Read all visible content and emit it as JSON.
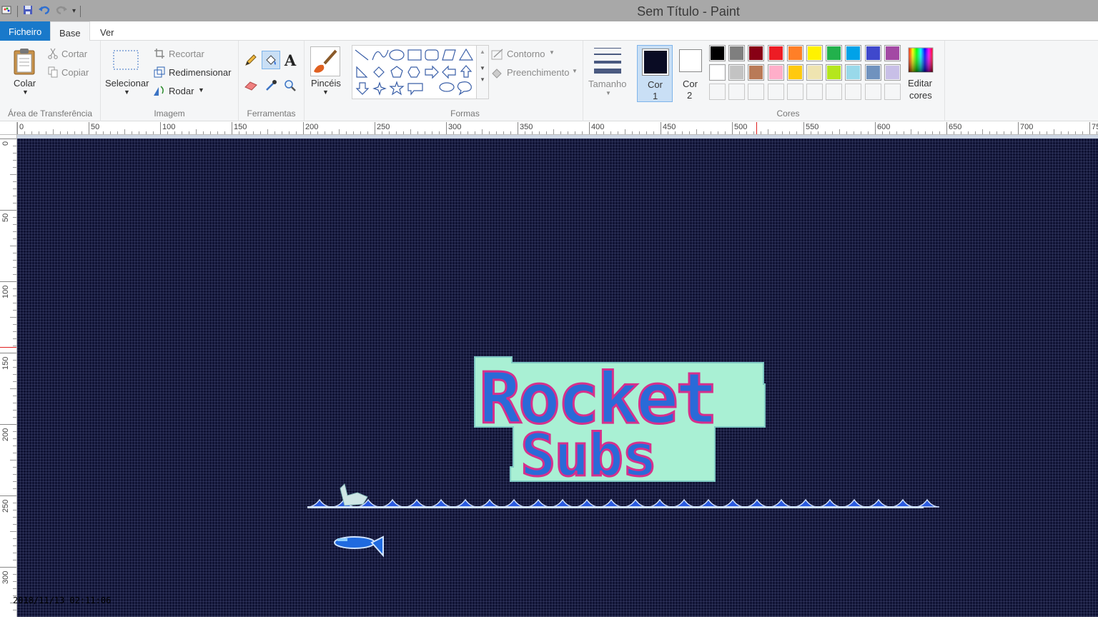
{
  "window": {
    "title": "Sem Título - Paint"
  },
  "quick_access": {
    "icons": [
      "paint-app-icon",
      "save-icon",
      "undo-icon",
      "redo-icon",
      "customize-qat-icon"
    ]
  },
  "tabs": {
    "file": "Ficheiro",
    "home": "Base",
    "view": "Ver"
  },
  "clipboard": {
    "paste": "Colar",
    "cut": "Cortar",
    "copy": "Copiar",
    "label": "Área de Transferência"
  },
  "image": {
    "select": "Selecionar",
    "crop": "Recortar",
    "resize": "Redimensionar",
    "rotate": "Rodar",
    "label": "Imagem"
  },
  "tools": {
    "label": "Ferramentas",
    "brushes": "Pincéis"
  },
  "shapes": {
    "label": "Formas",
    "outline": "Contorno",
    "fill": "Preenchimento"
  },
  "size": {
    "label": "Tamanho"
  },
  "colors": {
    "color1": "Cor",
    "color1_num": "1",
    "color2": "Cor",
    "color2_num": "2",
    "edit": "Editar",
    "edit2": "cores",
    "label": "Cores",
    "color1_value": "#0a0c24",
    "color2_value": "#ffffff",
    "palette_row1": [
      "#000000",
      "#7f7f7f",
      "#880015",
      "#ed1c24",
      "#ff7f27",
      "#fff200",
      "#22b14c",
      "#00a2e8",
      "#3f48cc",
      "#a349a4"
    ],
    "palette_row2": [
      "#ffffff",
      "#c3c3c3",
      "#b97a57",
      "#ffaec9",
      "#ffc90e",
      "#efe4b0",
      "#b5e61d",
      "#99d9ea",
      "#7092be",
      "#c8bfe7"
    ]
  },
  "ruler": {
    "h_ticks": [
      "0",
      "50",
      "100",
      "150",
      "200",
      "250",
      "300",
      "350",
      "400",
      "450",
      "500",
      "550",
      "600",
      "650",
      "700",
      "75"
    ],
    "v_ticks": [
      "0",
      "50",
      "100",
      "150",
      "200",
      "250",
      "300"
    ]
  },
  "canvas": {
    "logo_line1": "Rocket",
    "logo_line2": "Subs",
    "bg_color": "#0f1233"
  },
  "status": {
    "overlay_text": "2018/11/13 02:11:06"
  }
}
